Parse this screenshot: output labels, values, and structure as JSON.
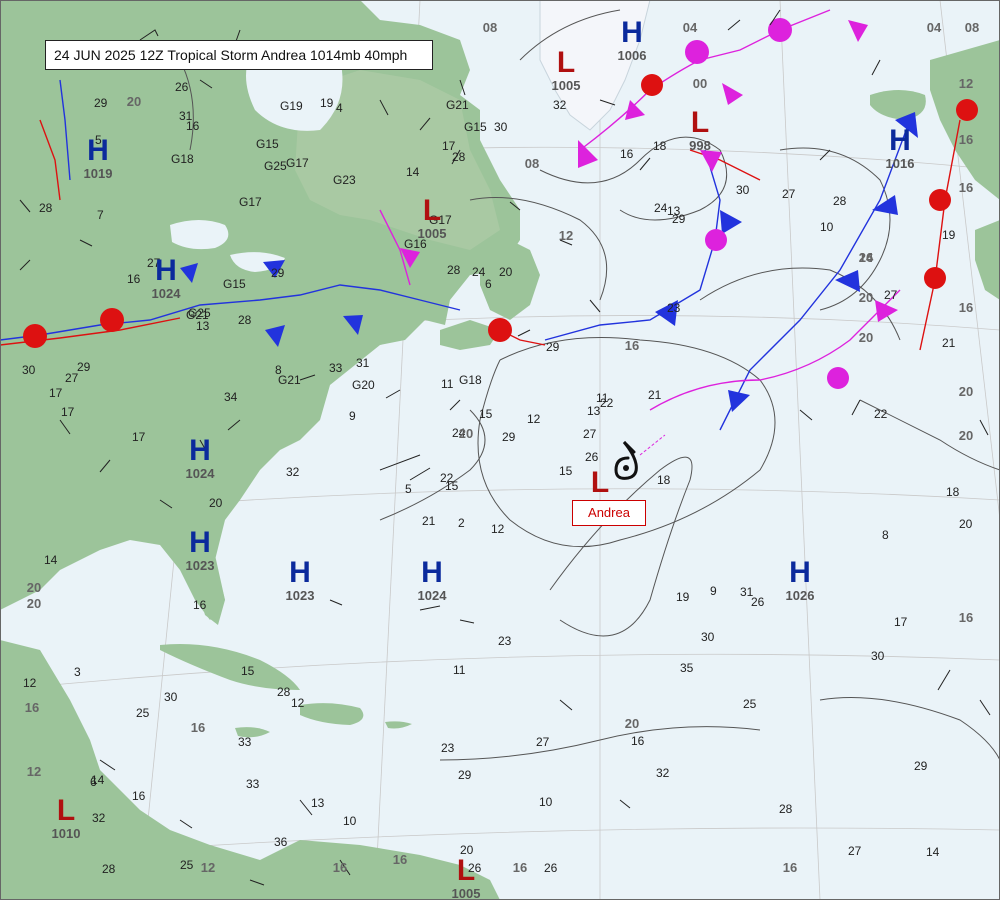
{
  "title": "24 JUN 2025 12Z Tropical Storm Andrea 1014mb 40mph",
  "storm": {
    "name": "Andrea",
    "symbol_color": "#111111"
  },
  "colors": {
    "ocean": "#eaf3f8",
    "land": "#9cc49a",
    "land_dark": "#7fae7c",
    "ice": "#f4f6fa",
    "high": "#0b2a9c",
    "low": "#b01010",
    "cold_front": "#2233dd",
    "warm_front": "#dd1111",
    "occluded_front": "#dd22dd",
    "isobar": "#555555",
    "isobar_label": "#666666"
  },
  "pressure_centers": [
    {
      "type": "H",
      "pressure": "1006"
    },
    {
      "type": "L",
      "pressure": "1005"
    },
    {
      "type": "L",
      "pressure": "998"
    },
    {
      "type": "H",
      "pressure": "1019"
    },
    {
      "type": "L",
      "pressure": "1005"
    },
    {
      "type": "H",
      "pressure": "1024"
    },
    {
      "type": "H",
      "pressure": "1024"
    },
    {
      "type": "H",
      "pressure": "1023"
    },
    {
      "type": "H",
      "pressure": "1023"
    },
    {
      "type": "H",
      "pressure": "1024"
    },
    {
      "type": "L",
      "pressure": ""
    },
    {
      "type": "H",
      "pressure": "1026"
    },
    {
      "type": "L",
      "pressure": "1010"
    },
    {
      "type": "H",
      "pressure": "1016"
    },
    {
      "type": "L",
      "pressure": "1005"
    }
  ],
  "isobar_labels": [
    "08",
    "04",
    "00",
    "08",
    "12",
    "16",
    "20",
    "24",
    "16",
    "20",
    "20",
    "20",
    "16",
    "20",
    "16",
    "12",
    "16",
    "20",
    "12",
    "16",
    "04",
    "08",
    "16",
    "16",
    "12",
    "20",
    "20",
    "16",
    "16",
    "20",
    "16",
    "16"
  ],
  "observations": [
    "12",
    "16",
    "15",
    "14",
    "13",
    "12",
    "18",
    "20",
    "13",
    "15",
    "16",
    "14",
    "17",
    "19",
    "21",
    "23",
    "25",
    "28",
    "29",
    "30",
    "31",
    "32",
    "33",
    "24",
    "22",
    "26",
    "27",
    "28",
    "17",
    "19",
    "21",
    "22",
    "23",
    "24",
    "29",
    "30",
    "28",
    "27",
    "29",
    "31",
    "32",
    "33",
    "34",
    "35",
    "36",
    "30",
    "27",
    "28",
    "29",
    "26",
    "25",
    "27",
    "28",
    "30",
    "32",
    "33",
    "31",
    "29",
    "27",
    "28",
    "30",
    "32",
    "29",
    "28",
    "27",
    "26",
    "16",
    "14",
    "15",
    "12",
    "11",
    "10",
    "9",
    "8",
    "6",
    "5",
    "13",
    "14",
    "11",
    "10",
    "12",
    "16",
    "18",
    "17",
    "20",
    "22",
    "23",
    "28",
    "26",
    "16",
    "17",
    "20",
    "21",
    "25",
    "29",
    "30",
    "27",
    "26",
    "24",
    "29",
    "20",
    "19",
    "18",
    "17",
    "16",
    "15",
    "13",
    "11",
    "10",
    "9",
    "8",
    "7",
    "6",
    "5",
    "4",
    "3",
    "2"
  ],
  "gusts": [
    "G15",
    "G17",
    "G19",
    "G21",
    "G21",
    "G23",
    "G25",
    "G16",
    "G15",
    "G18",
    "G21",
    "G17",
    "G18",
    "G25",
    "G20",
    "G17",
    "G15"
  ]
}
